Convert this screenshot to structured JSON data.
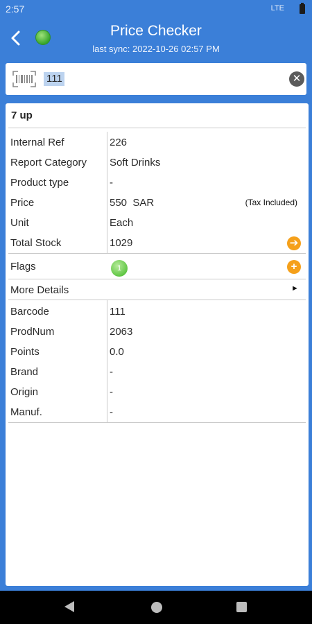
{
  "status": {
    "time": "2:57",
    "network": "LTE"
  },
  "header": {
    "title": "Price Checker",
    "subtitle": "last sync: 2022-10-26 02:57 PM",
    "back_icon": "back-arrow-icon",
    "status_indicator": "green-dot"
  },
  "search": {
    "value": "111",
    "scan_icon": "barcode-scan-icon",
    "clear_icon": "clear-circle-icon"
  },
  "product": {
    "name": "7 up",
    "internal_ref": {
      "label": "Internal Ref",
      "value": "226"
    },
    "report_category": {
      "label": "Report Category",
      "value": "Soft Drinks"
    },
    "product_type": {
      "label": "Product type",
      "value": "-"
    },
    "price": {
      "label": "Price",
      "value": "550  SAR",
      "note": "(Tax Included)"
    },
    "unit": {
      "label": "Unit",
      "value": "Each"
    },
    "total_stock": {
      "label": "Total Stock",
      "value": "1029",
      "action_symbol": "➔"
    },
    "flags": {
      "label": "Flags",
      "count": "1",
      "add_symbol": "+"
    },
    "more_details": {
      "label": "More Details",
      "chevron": "►"
    },
    "barcode": {
      "label": "Barcode",
      "value": "111"
    },
    "prodnum": {
      "label": "ProdNum",
      "value": "2063"
    },
    "points": {
      "label": "Points",
      "value": "0.0"
    },
    "brand": {
      "label": "Brand",
      "value": "-"
    },
    "origin": {
      "label": "Origin",
      "value": "-"
    },
    "manuf": {
      "label": "Manuf.",
      "value": "-"
    }
  },
  "colors": {
    "primary": "#3b7fd8",
    "accent": "#f5a01a",
    "status_green": "#37a52c",
    "selection": "#bcd3ef"
  }
}
